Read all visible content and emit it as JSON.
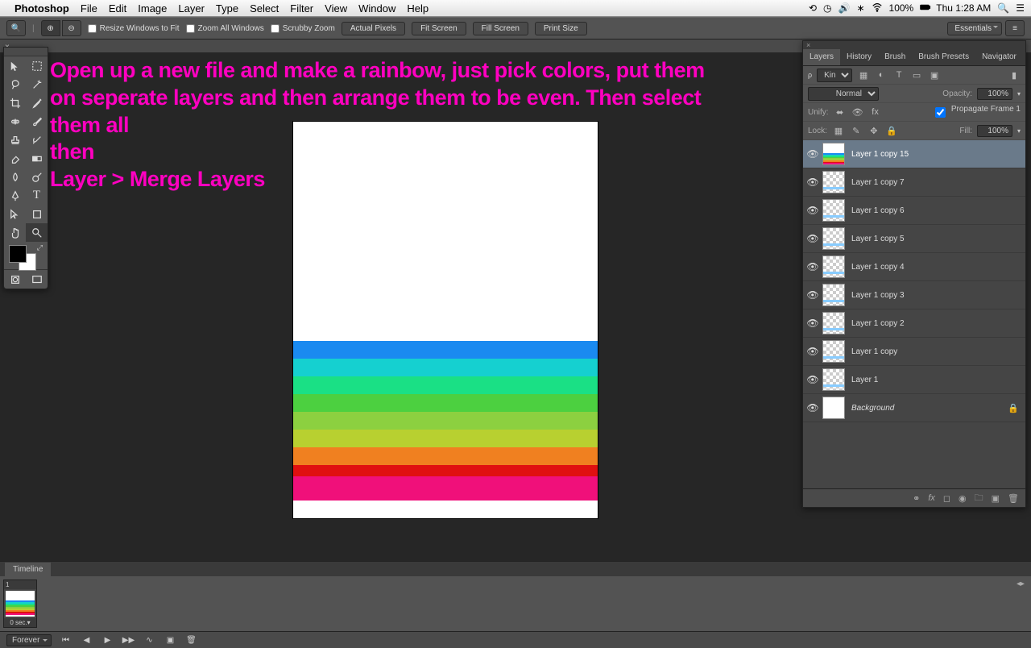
{
  "menubar": {
    "app": "Photoshop",
    "items": [
      "File",
      "Edit",
      "Image",
      "Layer",
      "Type",
      "Select",
      "Filter",
      "View",
      "Window",
      "Help"
    ],
    "battery": "100%",
    "clock": "Thu 1:28 AM"
  },
  "optbar": {
    "resize": "Resize Windows to Fit",
    "zoomall": "Zoom All Windows",
    "scrubby": "Scrubby Zoom",
    "actual": "Actual Pixels",
    "fitscreen": "Fit Screen",
    "fillscreen": "Fill Screen",
    "printsize": "Print Size",
    "workspace": "Essentials"
  },
  "doctab": "×",
  "overlay": "Open up a new file and make a rainbow, just pick colors, put them on seperate layers and then arrange them to be even. Then select them all\nthen\nLayer > Merge Layers",
  "stripes": [
    "#1a8af0",
    "#15d0d0",
    "#1ae085",
    "#4cd040",
    "#8cd040",
    "#b8d030",
    "#f08020",
    "#e01010",
    "#f0107a"
  ],
  "panels": {
    "tabs": [
      "Layers",
      "History",
      "Brush",
      "Brush Presets",
      "Navigator"
    ],
    "kind": "Kind",
    "blend": "Normal",
    "opacity_lbl": "Opacity:",
    "opacity": "100%",
    "unify": "Unify:",
    "propagate": "Propagate Frame 1",
    "lock": "Lock:",
    "fill_lbl": "Fill:",
    "fill": "100%",
    "layers": [
      {
        "name": "Layer 1 copy 15",
        "sel": true,
        "stripes": true
      },
      {
        "name": "Layer 1 copy 7"
      },
      {
        "name": "Layer 1 copy 6"
      },
      {
        "name": "Layer 1 copy 5"
      },
      {
        "name": "Layer 1 copy 4"
      },
      {
        "name": "Layer 1 copy 3"
      },
      {
        "name": "Layer 1 copy 2"
      },
      {
        "name": "Layer 1 copy"
      },
      {
        "name": "Layer 1"
      },
      {
        "name": "Background",
        "locked": true,
        "bg": true,
        "italic": true
      }
    ]
  },
  "timeline": {
    "tab": "Timeline",
    "frame_num": "1",
    "duration": "0 sec.",
    "loop": "Forever"
  }
}
